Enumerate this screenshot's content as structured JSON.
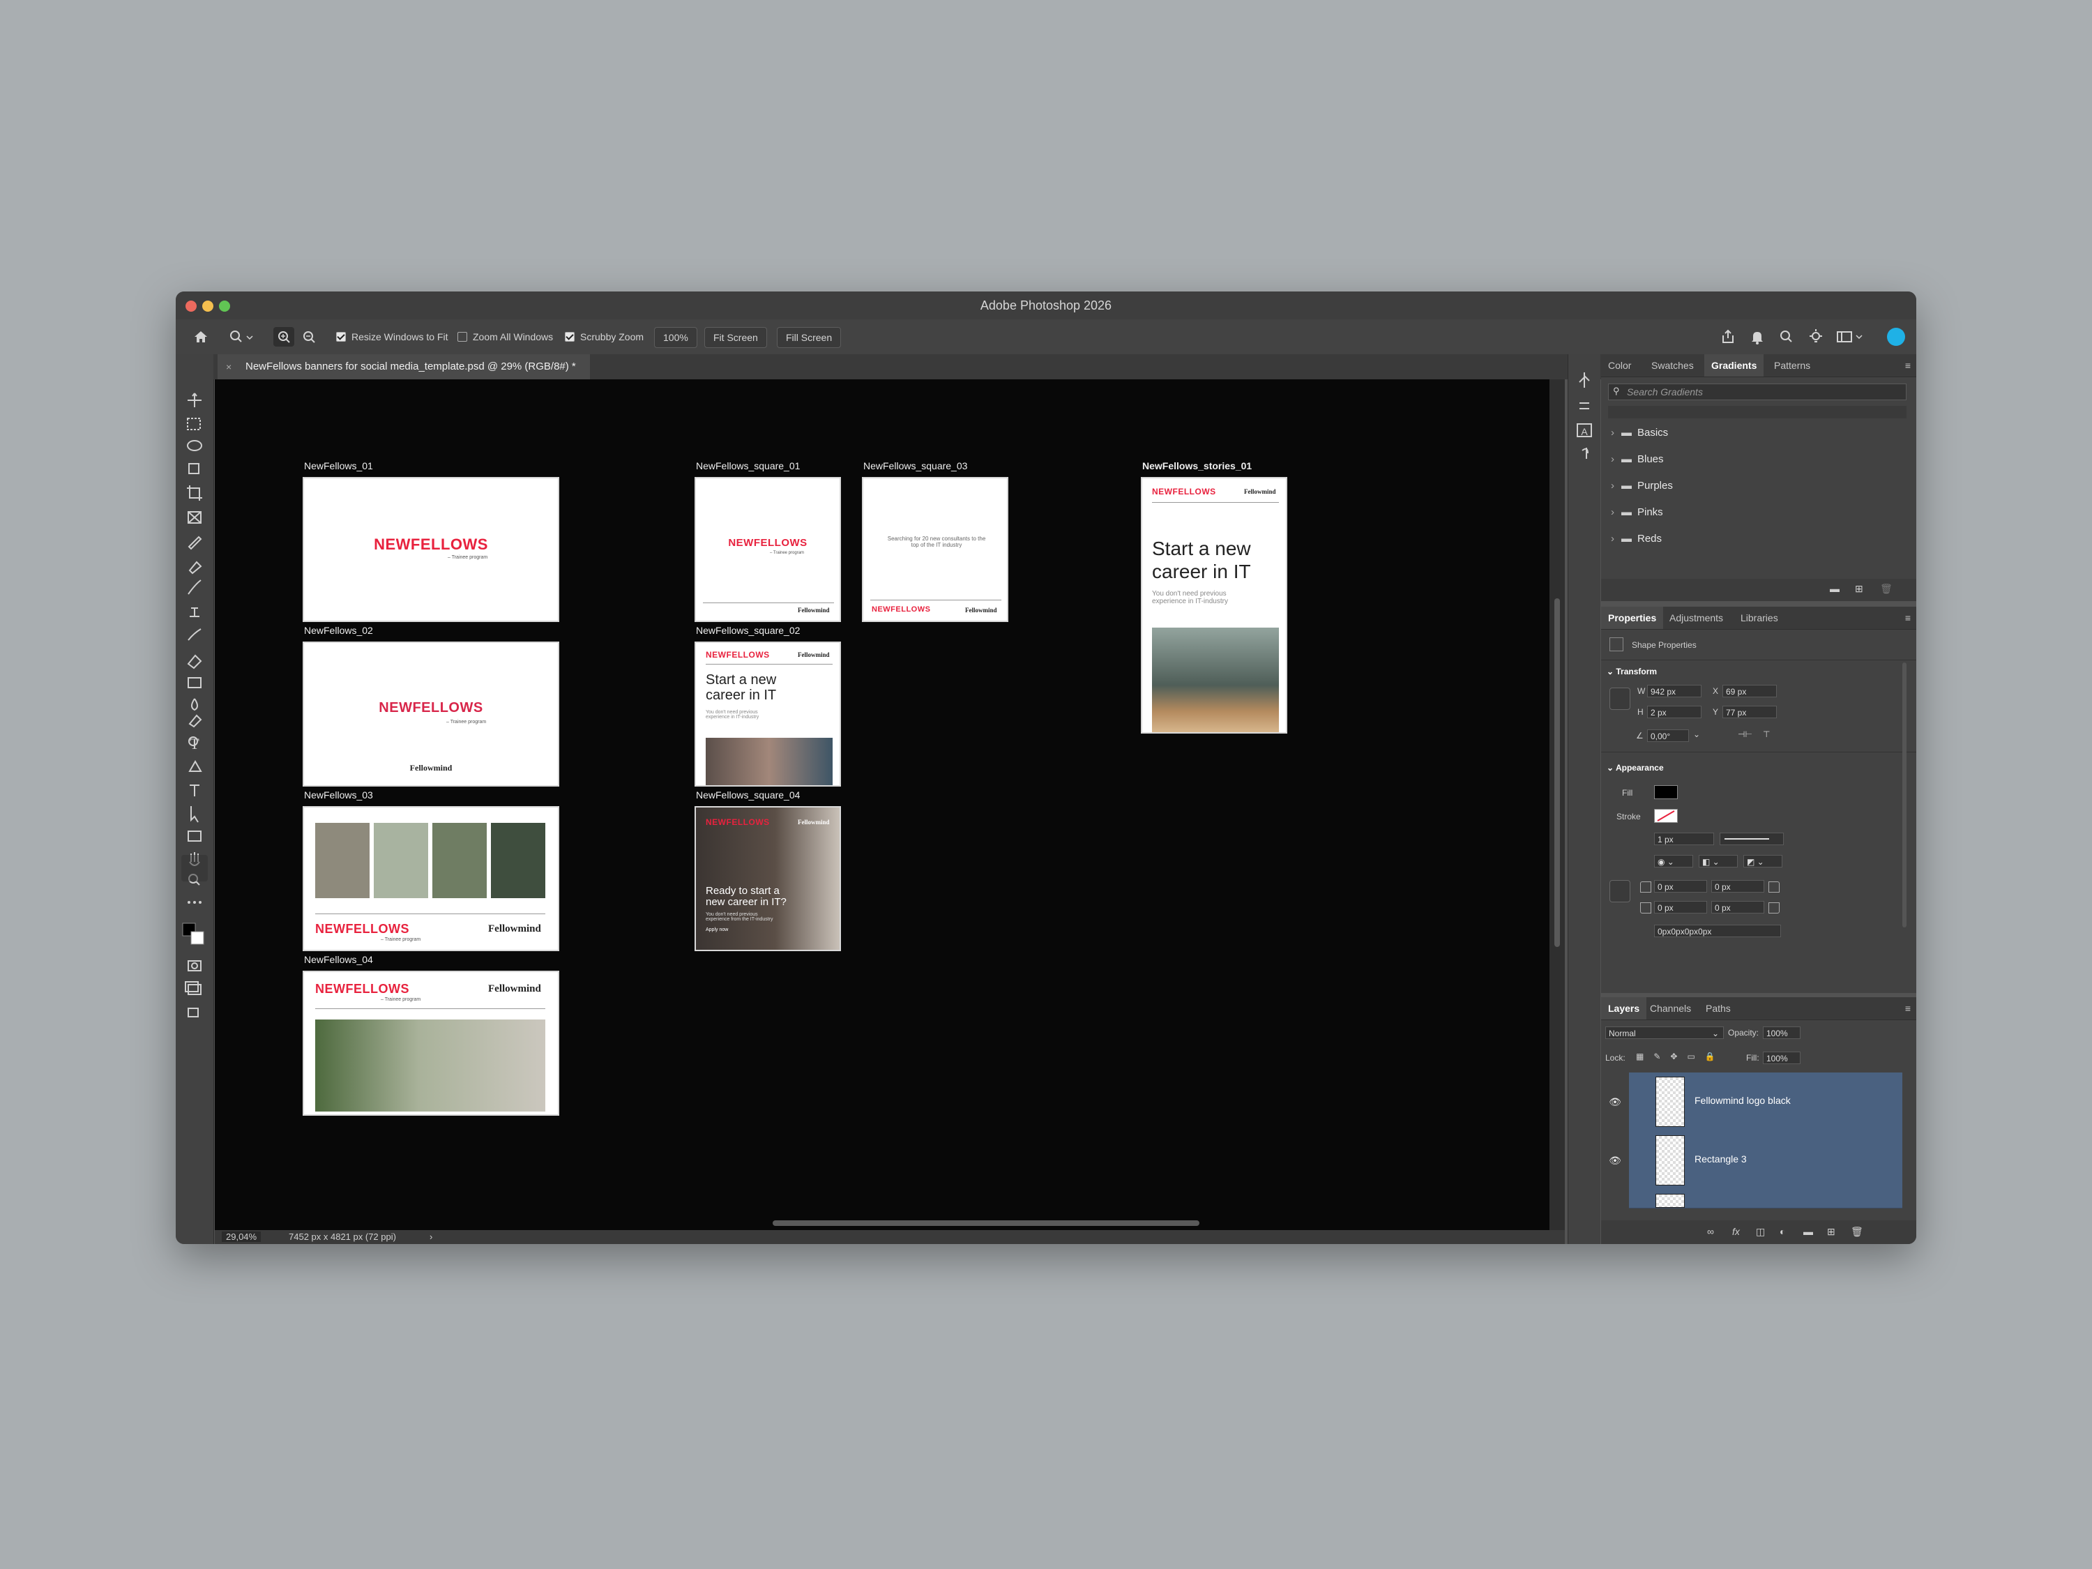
{
  "window": {
    "title": "Adobe Photoshop 2026"
  },
  "options_bar": {
    "resize_windows_label": "Resize Windows to Fit",
    "zoom_all_label": "Zoom All Windows",
    "scrubby_zoom_label": "Scrubby Zoom",
    "zoom_value": "100%",
    "fit_screen_label": "Fit Screen",
    "fill_screen_label": "Fill Screen"
  },
  "document": {
    "tab_title": "NewFellows banners for social media_template.psd @ 29% (RGB/8#) *"
  },
  "artboards": {
    "a1": {
      "label": "NewFellows_01",
      "logo": "NEWFELLOWS",
      "sub": "– Trainee program"
    },
    "a2": {
      "label": "NewFellows_02",
      "logo": "NEWFELLOWS",
      "sub": "– Trainee program",
      "brand": "Fellowmind"
    },
    "a3": {
      "label": "NewFellows_03",
      "logo": "NEWFELLOWS",
      "sub": "– Trainee program",
      "brand": "Fellowmind"
    },
    "a4": {
      "label": "NewFellows_04",
      "logo": "NEWFELLOWS",
      "sub": "– Trainee program",
      "brand": "Fellowmind"
    },
    "s1": {
      "label": "NewFellows_square_01",
      "logo": "NEWFELLOWS",
      "sub": "– Trainee program",
      "brand": "Fellowmind"
    },
    "s2": {
      "label": "NewFellows_square_02",
      "logo": "NEWFELLOWS",
      "brand": "Fellowmind",
      "headline": "Start a new career in IT",
      "body": "You don't need previous experience in IT-industry"
    },
    "s3": {
      "label": "NewFellows_square_03",
      "text": "Searching for 20 new consultants to the top of the IT industry",
      "logo": "NEWFELLOWS",
      "brand": "Fellowmind"
    },
    "s4": {
      "label": "NewFellows_square_04",
      "logo": "NEWFELLOWS",
      "brand": "Fellowmind",
      "headline": "Ready to start a new career in IT?",
      "body": "You don't need previous experience from the IT-industry",
      "cta": "Apply now"
    },
    "st1": {
      "label": "NewFellows_stories_01",
      "logo": "NEWFELLOWS",
      "brand": "Fellowmind",
      "headline": "Start a new career in IT",
      "body": "You don't need previous experience in IT-industry"
    }
  },
  "status": {
    "zoom": "29,04%",
    "doc_info": "7452 px x 4821 px (72 ppi)"
  },
  "gradients_panel": {
    "tabs": [
      "Color",
      "Swatches",
      "Gradients",
      "Patterns"
    ],
    "active_tab": "Gradients",
    "search_placeholder": "Search Gradients",
    "folders": [
      "Basics",
      "Blues",
      "Purples",
      "Pinks",
      "Reds"
    ]
  },
  "properties_panel": {
    "tabs": [
      "Properties",
      "Adjustments",
      "Libraries"
    ],
    "header": "Shape Properties",
    "transform_label": "Transform",
    "w_label": "W",
    "w": "942 px",
    "x_label": "X",
    "x": "69 px",
    "h_label": "H",
    "h": "2 px",
    "y_label": "Y",
    "y": "77 px",
    "angle": "0,00°",
    "appearance_label": "Appearance",
    "fill_label": "Fill",
    "stroke_label": "Stroke",
    "stroke_width": "1 px",
    "corner_tl": "0 px",
    "corner_tr": "0 px",
    "corner_bl": "0 px",
    "corner_br": "0 px",
    "corner_summary": "0px0px0px0px"
  },
  "layers_panel": {
    "tabs": [
      "Layers",
      "Channels",
      "Paths"
    ],
    "blend_mode": "Normal",
    "opacity_label": "Opacity:",
    "opacity": "100%",
    "lock_label": "Lock:",
    "fill_label": "Fill:",
    "fill": "100%",
    "layers": [
      {
        "name": "Fellowmind logo black"
      },
      {
        "name": "Rectangle 3"
      }
    ]
  },
  "colors": {
    "accent": "#e8223e",
    "magenta": "#c21c8a",
    "layer_selected": "#4a6180",
    "user_avatar": "#1fb1e6"
  }
}
